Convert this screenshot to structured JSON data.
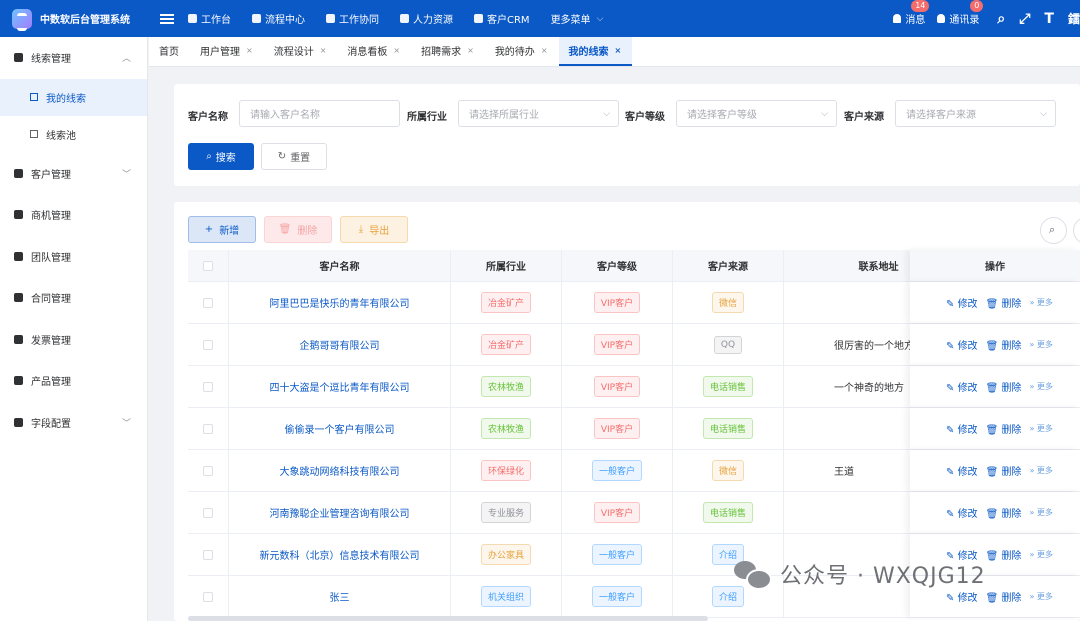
{
  "app": {
    "title": "中数软后台管理系统"
  },
  "topnav": [
    {
      "label": "工作台",
      "icon": "send-icon"
    },
    {
      "label": "流程中心",
      "icon": "flow-icon"
    },
    {
      "label": "工作协同",
      "icon": "document-icon"
    },
    {
      "label": "人力资源",
      "icon": "chat-icon"
    },
    {
      "label": "客户CRM",
      "icon": "users-icon"
    },
    {
      "label": "更多菜单",
      "icon": "chevron-down-icon"
    }
  ],
  "topright": {
    "messages_label": "消息",
    "messages_count": "14",
    "contacts_label": "通讯录",
    "contacts_count": "0",
    "extra_char": "鐳"
  },
  "sidebar": [
    {
      "label": "线索管理",
      "icon": "person-icon",
      "expanded": true
    },
    {
      "label": "我的线索",
      "icon": "list-icon",
      "active": true
    },
    {
      "label": "线索池",
      "icon": "pool-icon"
    },
    {
      "label": "客户管理",
      "icon": "chat-icon",
      "arrow": true
    },
    {
      "label": "商机管理",
      "icon": "bug-icon"
    },
    {
      "label": "团队管理",
      "icon": "move-icon"
    },
    {
      "label": "合同管理",
      "icon": "document-icon"
    },
    {
      "label": "发票管理",
      "icon": "settings-icon"
    },
    {
      "label": "产品管理",
      "icon": "cart-icon"
    },
    {
      "label": "字段配置",
      "icon": "dashboard-icon",
      "arrow": true
    }
  ],
  "tabs": [
    {
      "label": "首页"
    },
    {
      "label": "用户管理",
      "close": "×"
    },
    {
      "label": "流程设计",
      "close": "×"
    },
    {
      "label": "消息看板",
      "close": "×"
    },
    {
      "label": "招聘需求",
      "close": "×"
    },
    {
      "label": "我的待办",
      "close": "×"
    },
    {
      "label": "我的线索",
      "close": "×",
      "active": true
    }
  ],
  "search": {
    "name_label": "客户名称",
    "name_placeholder": "请输入客户名称",
    "industry_label": "所属行业",
    "industry_placeholder": "请选择所属行业",
    "level_label": "客户等级",
    "level_placeholder": "请选择客户等级",
    "source_label": "客户来源",
    "source_placeholder": "请选择客户来源",
    "search_button": "搜索",
    "reset_button": "重置"
  },
  "toolbar": {
    "add": "新增",
    "delete": "删除",
    "export": "导出"
  },
  "table": {
    "headers": [
      "客户名称",
      "所属行业",
      "客户等级",
      "客户来源",
      "联系地址",
      "操作"
    ],
    "ops": {
      "edit": "修改",
      "delete": "删除",
      "more": "更多"
    },
    "rows": [
      {
        "name": "阿里巴巴是快乐的青年有限公司",
        "industry": "冶金矿产",
        "industry_color": "red",
        "level": "VIP客户",
        "level_color": "red",
        "source": "微信",
        "source_color": "orange",
        "address": ""
      },
      {
        "name": "企鹅哥哥有限公司",
        "industry": "冶金矿产",
        "industry_color": "red",
        "level": "VIP客户",
        "level_color": "red",
        "source": "QQ",
        "source_color": "gray",
        "address": "很厉害的一个地方"
      },
      {
        "name": "四十大盗是个逗比青年有限公司",
        "industry": "农林牧渔",
        "industry_color": "green",
        "level": "VIP客户",
        "level_color": "red",
        "source": "电话销售",
        "source_color": "green",
        "address": "一个神奇的地方"
      },
      {
        "name": "偷偷录一个客户有限公司",
        "industry": "农林牧渔",
        "industry_color": "green",
        "level": "VIP客户",
        "level_color": "red",
        "source": "电话销售",
        "source_color": "green",
        "address": ""
      },
      {
        "name": "大象跳动网络科技有限公司",
        "industry": "环保绿化",
        "industry_color": "red",
        "level": "一般客户",
        "level_color": "blue",
        "source": "微信",
        "source_color": "orange",
        "address": "王道"
      },
      {
        "name": "河南豫聪企业管理咨询有限公司",
        "industry": "专业服务",
        "industry_color": "gray",
        "level": "VIP客户",
        "level_color": "red",
        "source": "电话销售",
        "source_color": "green",
        "address": ""
      },
      {
        "name": "新元数科（北京）信息技术有限公司",
        "industry": "办公家具",
        "industry_color": "orange",
        "level": "一般客户",
        "level_color": "blue",
        "source": "介绍",
        "source_color": "blue",
        "address": ""
      },
      {
        "name": "张三",
        "industry": "机关组织",
        "industry_color": "blue",
        "level": "一般客户",
        "level_color": "blue",
        "source": "介绍",
        "source_color": "blue",
        "address": ""
      }
    ]
  },
  "watermark": {
    "text": "公众号 · WXQJG12"
  }
}
